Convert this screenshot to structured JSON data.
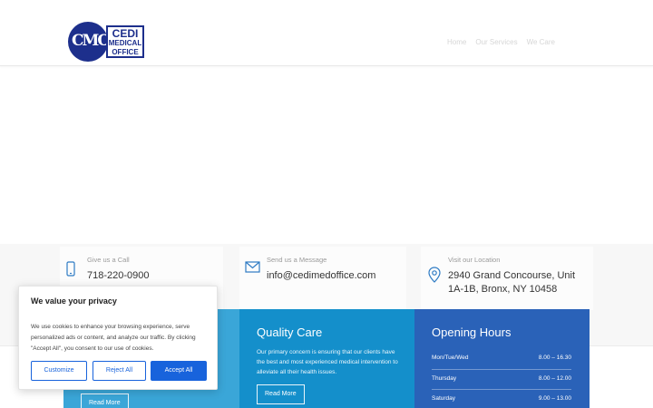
{
  "logo": {
    "line1": "CEDI",
    "line2": "MEDICAL",
    "line3": "OFFICE",
    "monogram": "CMO"
  },
  "nav": {
    "items": [
      "Home",
      "Our Services",
      "We Care"
    ]
  },
  "contact": [
    {
      "label": "Give us a Call",
      "value": "718-220-0900",
      "icon": "phone-icon"
    },
    {
      "label": "Send us a Message",
      "value": "info@cedimedoffice.com",
      "icon": "envelope-icon"
    },
    {
      "label": "Visit our Location",
      "value_line1": "2940 Grand Concourse, Unit",
      "value_line2": "1A-1B, Bronx, NY 10458",
      "icon": "map-pin-icon"
    }
  ],
  "panels": {
    "first": {
      "read_more": "Read More"
    },
    "quality": {
      "title": "Quality Care",
      "description": "Our primary concern is ensuring that our clients have the best and most experienced medical intervention to alleviate all their health issues.",
      "read_more": "Read More"
    },
    "hours": {
      "title": "Opening Hours",
      "rows": [
        {
          "day": "Mon/Tue/Wed",
          "time": "8.00 – 16.30"
        },
        {
          "day": "Thursday",
          "time": "8.00 – 12.00"
        },
        {
          "day": "Saturday",
          "time": "9.00 – 13.00"
        }
      ]
    }
  },
  "cookie": {
    "title": "We value your privacy",
    "text": "We use cookies to enhance your browsing experience, serve personalized ads or content, and analyze our traffic. By clicking \"Accept All\", you consent to our use of cookies.",
    "customize": "Customize",
    "reject": "Reject All",
    "accept": "Accept All"
  },
  "colors": {
    "brand": "#1d2f8c",
    "panel_light": "#3aa6d8",
    "panel_mid": "#148fcb",
    "panel_dark": "#2a62b8",
    "cookie_accent": "#1863dc",
    "icon_blue": "#2e7bc4"
  }
}
